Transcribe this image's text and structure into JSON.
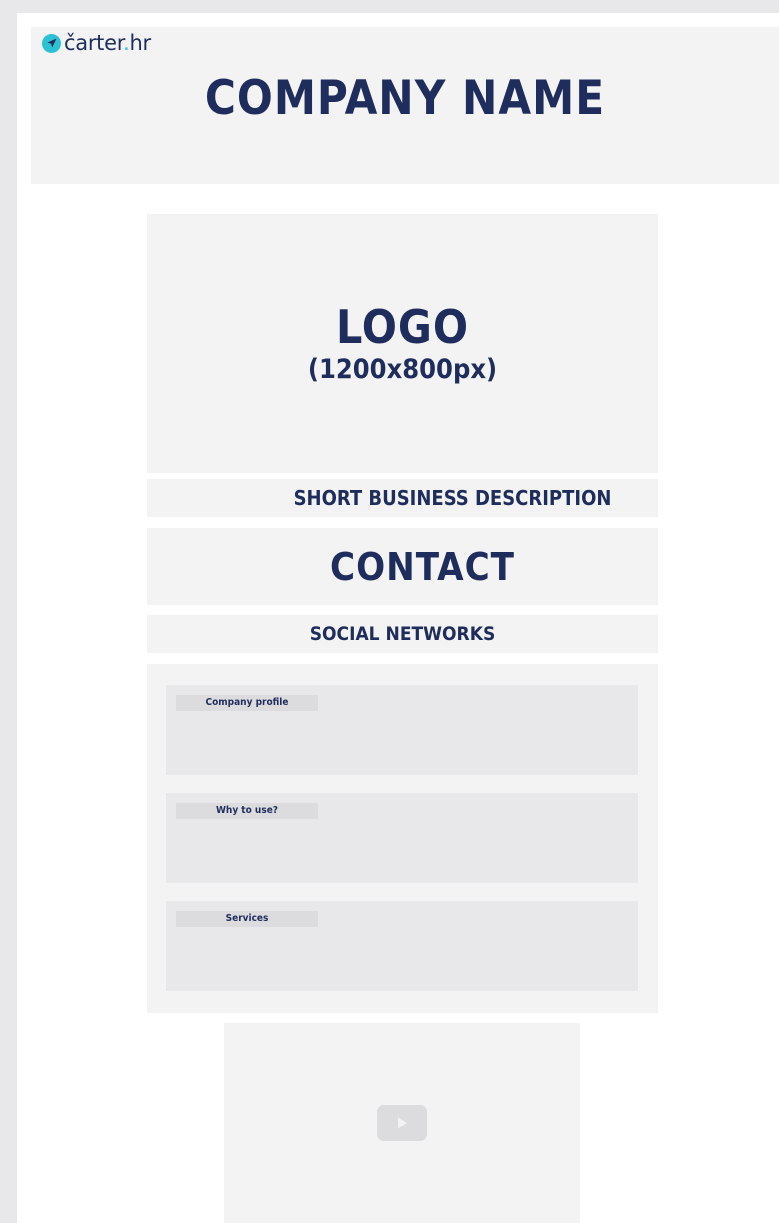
{
  "brand": {
    "name": "čarter.hr",
    "name_main": "čarter",
    "name_tld": "hr"
  },
  "header": {
    "company_name": "COMPANY NAME"
  },
  "logo": {
    "title": "LOGO",
    "size": "(1200x800px)"
  },
  "description": {
    "label": "SHORT BUSINESS DESCRIPTION"
  },
  "contact": {
    "label": "CONTACT"
  },
  "social": {
    "label": "SOCIAL NETWORKS"
  },
  "sections": [
    {
      "label": "Company profile"
    },
    {
      "label": "Why to use?"
    },
    {
      "label": "Services"
    }
  ],
  "video": {
    "icon": "play-icon"
  },
  "colors": {
    "brand_accent": "#2cc2d3",
    "heading": "#1f2d5c",
    "panel": "#f3f3f4",
    "subpanel": "#e8e8ea"
  }
}
